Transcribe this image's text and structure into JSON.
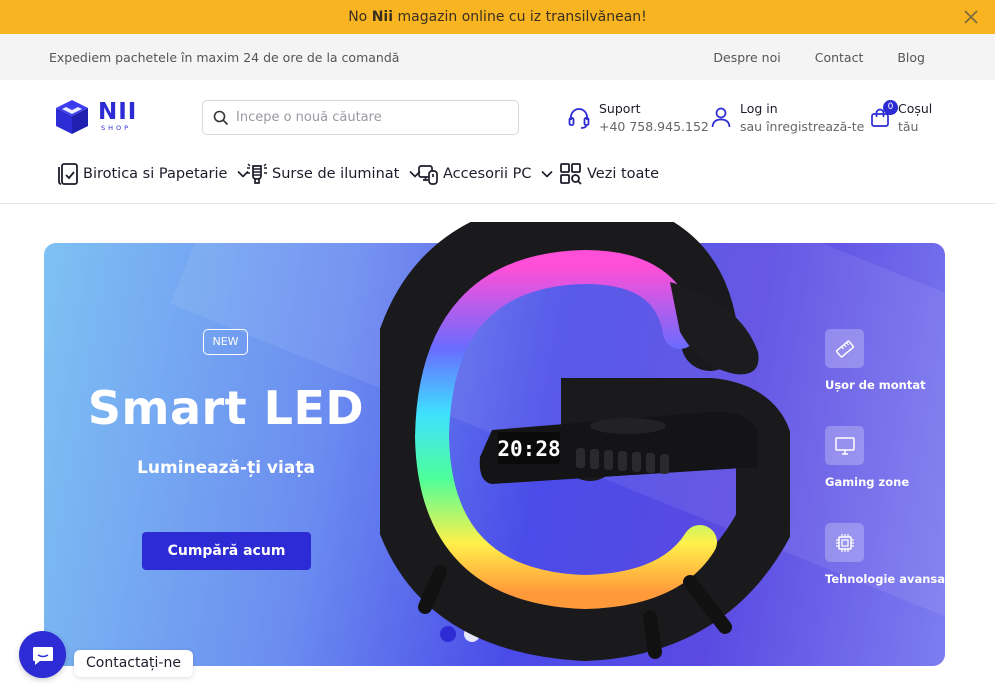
{
  "announcement": {
    "prefix": "No",
    "brand": "Nii",
    "suffix": "magazin online cu iz transilvănean!"
  },
  "topbar": {
    "shipping": "Expediem pachetele în maxim 24 de ore de la comandă",
    "links": [
      "Despre noi",
      "Contact",
      "Blog"
    ]
  },
  "logo": {
    "big": "NII",
    "small": "SHOP"
  },
  "search": {
    "placeholder": "Începe o nouă căutare",
    "value": ""
  },
  "support": {
    "title": "Suport",
    "phone": "+40 758.945.152"
  },
  "account": {
    "title": "Log in",
    "subtitle": "sau înregistrează-te"
  },
  "cart": {
    "title": "Coșul",
    "subtitle": "tău",
    "count": "0"
  },
  "nav": [
    {
      "label": "Birotica si Papetarie",
      "icon": "stationery-icon",
      "dropdown": true
    },
    {
      "label": "Surse de iluminat",
      "icon": "bulb-icon",
      "dropdown": true
    },
    {
      "label": "Accesorii PC",
      "icon": "pc-accessories-icon",
      "dropdown": true
    },
    {
      "label": "Vezi toate",
      "icon": "grid-search-icon",
      "dropdown": false
    }
  ],
  "hero": {
    "tag": "NEW",
    "title": "Smart LED",
    "subtitle": "Luminează-ți viața",
    "cta": "Cumpără acum",
    "clock": "20:28",
    "features": [
      {
        "label": "Ușor de montat",
        "icon": "ruler-icon"
      },
      {
        "label": "Gaming zone",
        "icon": "monitor-icon"
      },
      {
        "label": "Tehnologie avansată",
        "icon": "chip-icon"
      }
    ],
    "slides": 5,
    "active_slide": 1
  },
  "chat": {
    "label": "Contactați-ne"
  },
  "colors": {
    "accent": "#2c2bd4",
    "announce": "#f9b421"
  }
}
